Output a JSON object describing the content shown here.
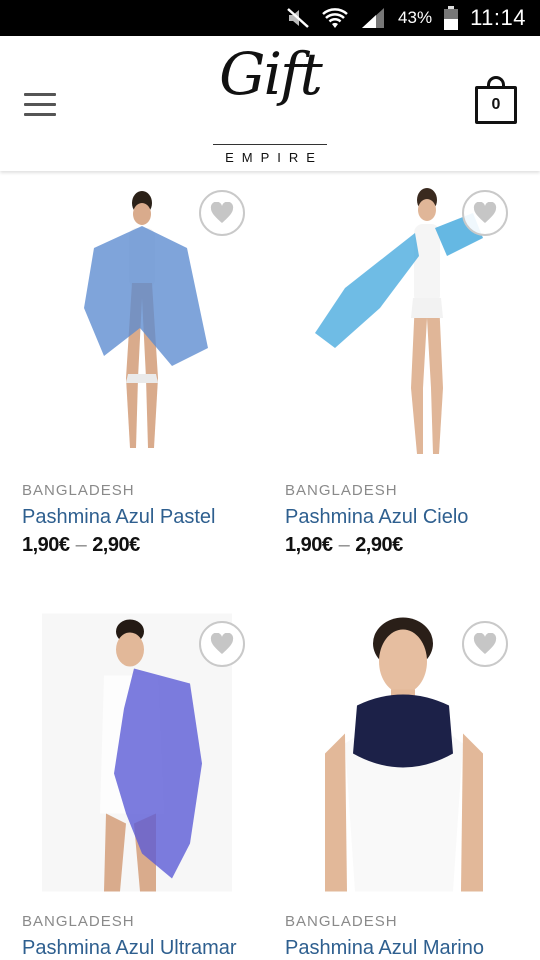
{
  "status_bar": {
    "battery": "43%",
    "time": "11:14"
  },
  "header": {
    "logo_script": "Gift",
    "logo_sub": "EMPIRE",
    "cart_count": "0"
  },
  "products": [
    {
      "category": "BANGLADESH",
      "title": "Pashmina Azul Pastel",
      "price_min": "1,90€",
      "dash": "–",
      "price_max": "2,90€",
      "scarf_color": "#5b8bd0"
    },
    {
      "category": "BANGLADESH",
      "title": "Pashmina Azul Cielo",
      "price_min": "1,90€",
      "dash": "–",
      "price_max": "2,90€",
      "scarf_color": "#3fa6dc"
    },
    {
      "category": "BANGLADESH",
      "title": "Pashmina Azul Ultramar",
      "scarf_color": "#5b5bd6"
    },
    {
      "category": "BANGLADESH",
      "title": "Pashmina Azul Marino",
      "scarf_color": "#1c2148"
    }
  ],
  "colors": {
    "title_link": "#2e5f8f",
    "category": "#8a8a8a"
  }
}
